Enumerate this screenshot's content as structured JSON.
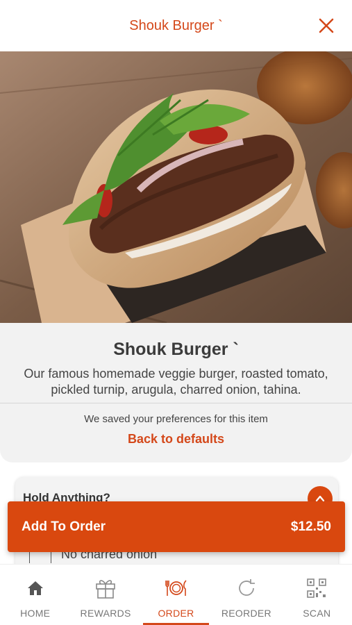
{
  "header": {
    "title": "Shouk Burger `",
    "close_icon": "close-icon",
    "accent_color": "#d4481a"
  },
  "item": {
    "title": "Shouk Burger `",
    "description": "Our famous homemade veggie burger, roasted tomato, pickled turnip, arugula, charred onion, tahina.",
    "preferences_note": "We saved your preferences for this item",
    "back_to_defaults": "Back to defaults"
  },
  "options": {
    "header": "Hold Anything?",
    "expanded": true,
    "items": [
      {
        "label": "No charred onion",
        "checked": false
      }
    ]
  },
  "cta": {
    "label": "Add To Order",
    "price": "$12.50",
    "color": "#d9480f"
  },
  "nav": {
    "items": [
      {
        "label": "HOME",
        "icon": "home-icon",
        "active": false
      },
      {
        "label": "REWARDS",
        "icon": "gift-icon",
        "active": false
      },
      {
        "label": "ORDER",
        "icon": "plate-cutlery-icon",
        "active": true
      },
      {
        "label": "REORDER",
        "icon": "refresh-icon",
        "active": false
      },
      {
        "label": "SCAN",
        "icon": "qr-code-icon",
        "active": false
      }
    ]
  }
}
